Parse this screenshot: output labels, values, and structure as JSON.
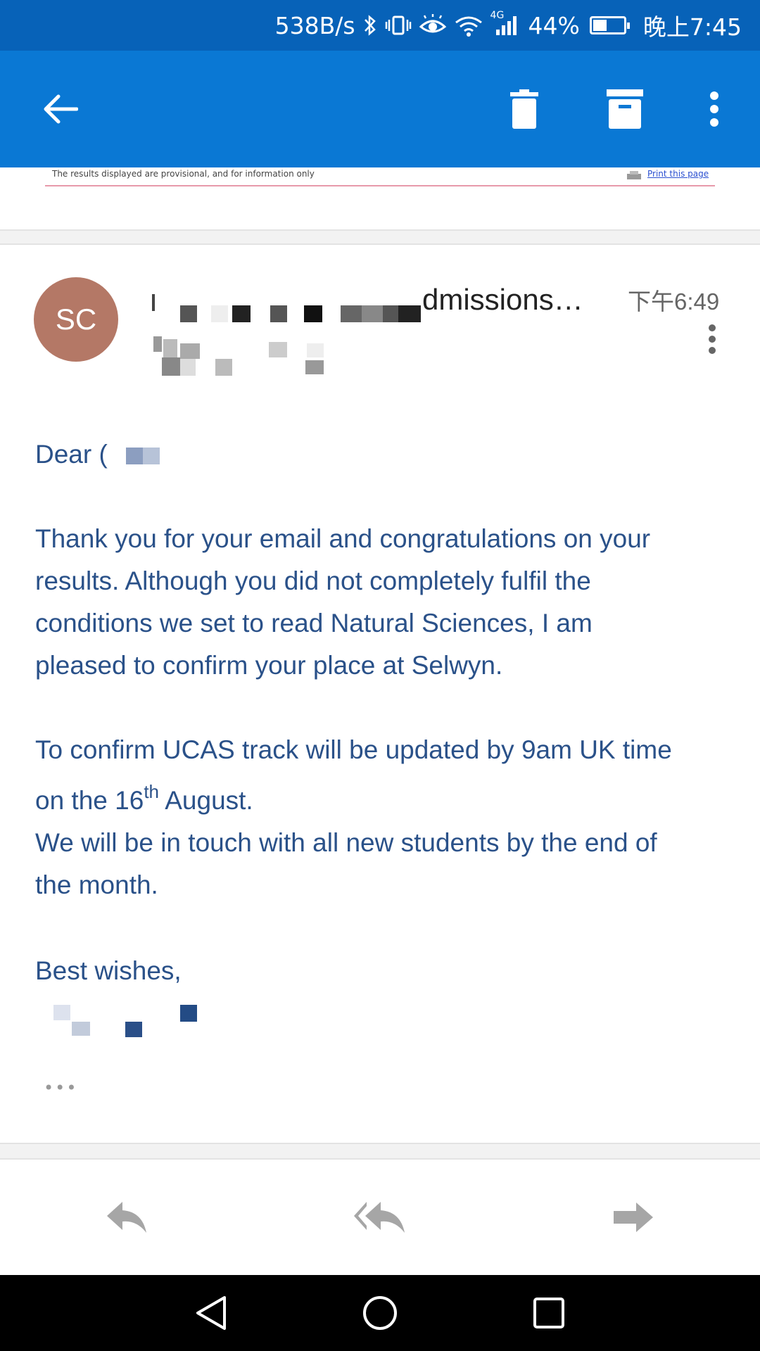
{
  "status_bar": {
    "net_speed": "538B/s",
    "signal_label": "4G",
    "battery": "44%",
    "battery_level": 0.44,
    "time": "晚上7:45"
  },
  "app_bar": {
    "icons": [
      "back-arrow-icon",
      "trash-icon",
      "archive-icon",
      "more-vert-icon"
    ]
  },
  "quoted": {
    "notice": "The results displayed are provisional, and for information only",
    "print_link": "Print this page"
  },
  "message": {
    "avatar_initials": "SC",
    "sender_visible": "dmissions…",
    "time": "下午6:49",
    "greeting": "Dear (",
    "paragraph1": [
      "Thank you for your email and congratulations on your",
      "results. Although you did not completely fulfil the",
      "conditions we set to read Natural Sciences, I am",
      "pleased to confirm your place at Selwyn."
    ],
    "p2_line1": "To confirm UCAS track will be updated by 9am UK time",
    "p2_line2_pre": "on the 16",
    "p2_line2_sup": "th",
    "p2_line2_post": " August.",
    "p2_line3": "We will be in touch with all new students by the end of",
    "p2_line4": "the month.",
    "signoff": "Best wishes,",
    "more": "•••"
  },
  "bottom_actions": [
    "reply-icon",
    "reply-all-icon",
    "forward-icon"
  ],
  "colors": {
    "status_bar": "#0762b8",
    "app_bar": "#0a78d4",
    "body_text": "#2a5189",
    "avatar": "#b47866"
  }
}
